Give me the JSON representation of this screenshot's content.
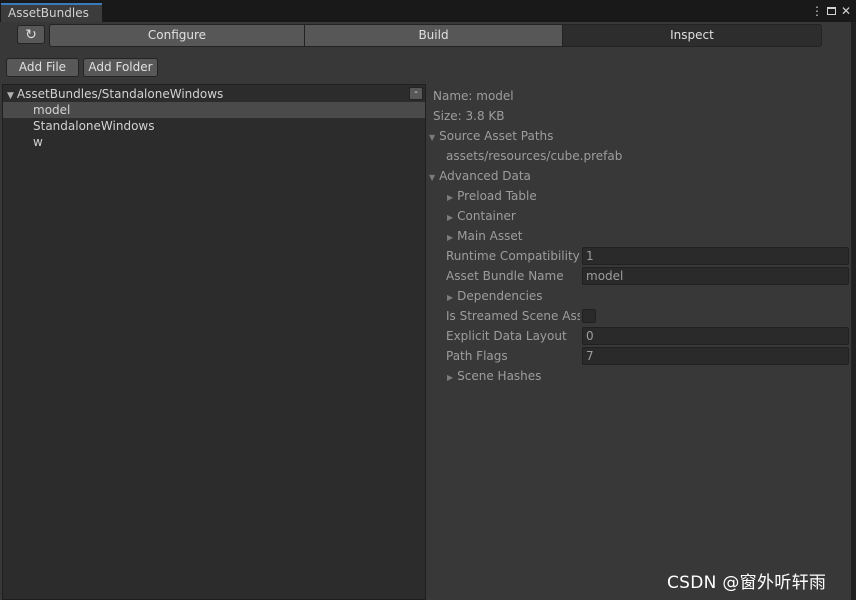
{
  "window": {
    "tab_title": "AssetBundles",
    "menu_icon": "kebab-menu-icon",
    "maximize_icon": "maximize-icon",
    "close_icon": "close-icon"
  },
  "toolbar": {
    "refresh_icon": "refresh-icon",
    "tabs": [
      {
        "label": "Configure",
        "active": false
      },
      {
        "label": "Build",
        "active": false
      },
      {
        "label": "Inspect",
        "active": true
      }
    ],
    "add_file_label": "Add File",
    "add_folder_label": "Add Folder"
  },
  "tree": {
    "root_label": "AssetBundles/StandaloneWindows",
    "collapse_label": "-",
    "items": [
      {
        "label": "model",
        "selected": true
      },
      {
        "label": "StandaloneWindows",
        "selected": false
      },
      {
        "label": "w",
        "selected": false
      }
    ]
  },
  "inspect": {
    "name": "Name: model",
    "size": "Size: 3.8 KB",
    "source_asset_paths_label": "Source Asset Paths",
    "source_asset_path": "assets/resources/cube.prefab",
    "advanced_data_label": "Advanced Data",
    "preload_table_label": "Preload Table",
    "container_label": "Container",
    "main_asset_label": "Main Asset",
    "runtime_compat_label": "Runtime Compatibility",
    "runtime_compat_value": "1",
    "asset_bundle_name_label": "Asset Bundle Name",
    "asset_bundle_name_value": "model",
    "dependencies_label": "Dependencies",
    "is_streamed_label": "Is Streamed Scene Asse",
    "is_streamed_checked": false,
    "explicit_layout_label": "Explicit Data Layout",
    "explicit_layout_value": "0",
    "path_flags_label": "Path Flags",
    "path_flags_value": "7",
    "scene_hashes_label": "Scene Hashes"
  },
  "watermark": "CSDN @窗外听轩雨",
  "colors": {
    "accent": "#3a79bb",
    "panel_bg": "#383838",
    "tree_bg": "#2c2c2c",
    "selected_row": "#4a4a4a"
  }
}
